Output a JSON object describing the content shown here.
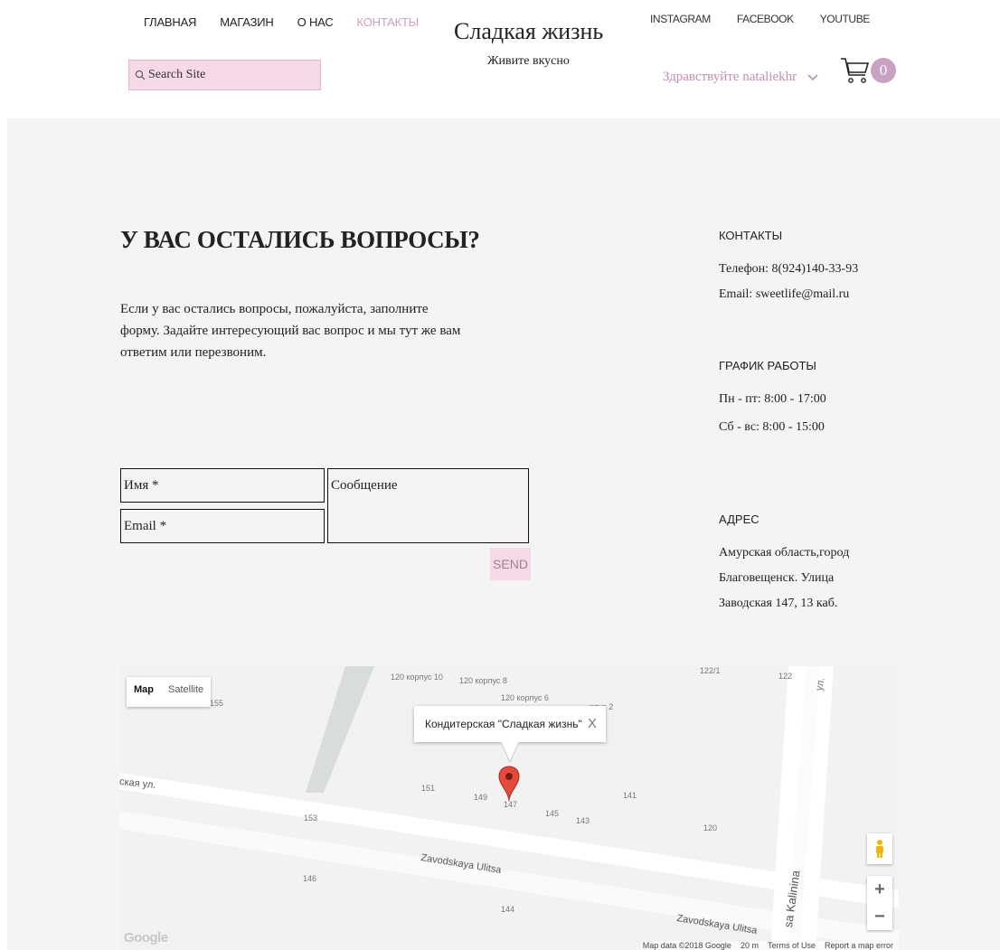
{
  "nav": {
    "items": [
      "ГЛАВНАЯ",
      "МАГАЗИН",
      "О НАС",
      "КОНТАКТЫ"
    ],
    "active": "КОНТАКТЫ"
  },
  "search": {
    "placeholder": "Search Site"
  },
  "brand": {
    "title": "Сладкая жизнь",
    "tagline": "Живите вкусно"
  },
  "social": [
    "INSTAGRAM",
    "FACEBOOK",
    "YOUTUBE"
  ],
  "user": {
    "greeting": "Здравствуйте nataliekhr"
  },
  "cart": {
    "count": "0"
  },
  "colors": {
    "accent": "#c9a2c2",
    "pink_bg": "#f6d9e8",
    "page_bg": "#f4f4f4"
  },
  "contact_form": {
    "heading": "У ВАС ОСТАЛИСЬ ВОПРОСЫ?",
    "intro": "Если у вас остались вопросы, пожалуйста, заполните форму. Задайте интересующий вас вопрос и мы тут же вам ответим или перезвоним.",
    "name_placeholder": "Имя *",
    "email_placeholder": "Email *",
    "message_placeholder": "Сообщение",
    "send_label": "SEND"
  },
  "sidebar": {
    "contacts_title": "КОНТАКТЫ",
    "phone": "Телефон: 8(924)140-33-93",
    "email": "Email: sweetlife@mail.ru",
    "hours_title": "ГРАФИК РАБОТЫ",
    "weekdays": "Пн - пт: 8:00 - 17:00",
    "weekend": "Сб - вс: 8:00 - 15:00",
    "address_title": "АДРЕС",
    "address_lines": [
      "Амурская область,город",
      "Благовещенск. Улица",
      "Заводская 147, 13 каб."
    ]
  },
  "map": {
    "type_buttons": [
      "Map",
      "Satellite"
    ],
    "info_window": "Кондитерская \"Сладкая жизнь\"",
    "close_glyph": "X",
    "labels": [
      "155",
      "120 корпус 10",
      "120 корпус 8",
      "120 корпус 6",
      "122/1",
      "122",
      "151",
      "149",
      "147",
      "145",
      "143",
      "141",
      "153",
      "120",
      "146",
      "144",
      "рпус 2",
      "ул."
    ],
    "streets": [
      "Zavodskaya Ulitsa",
      "Zavodskaya Ulitsa",
      "ская ул.",
      "sa Kalinina"
    ],
    "zoom_in": "+",
    "zoom_out": "−",
    "logo": "Google",
    "footer": [
      "Map data ©2018 Google",
      "20 m",
      "Terms of Use",
      "Report a map error"
    ]
  }
}
